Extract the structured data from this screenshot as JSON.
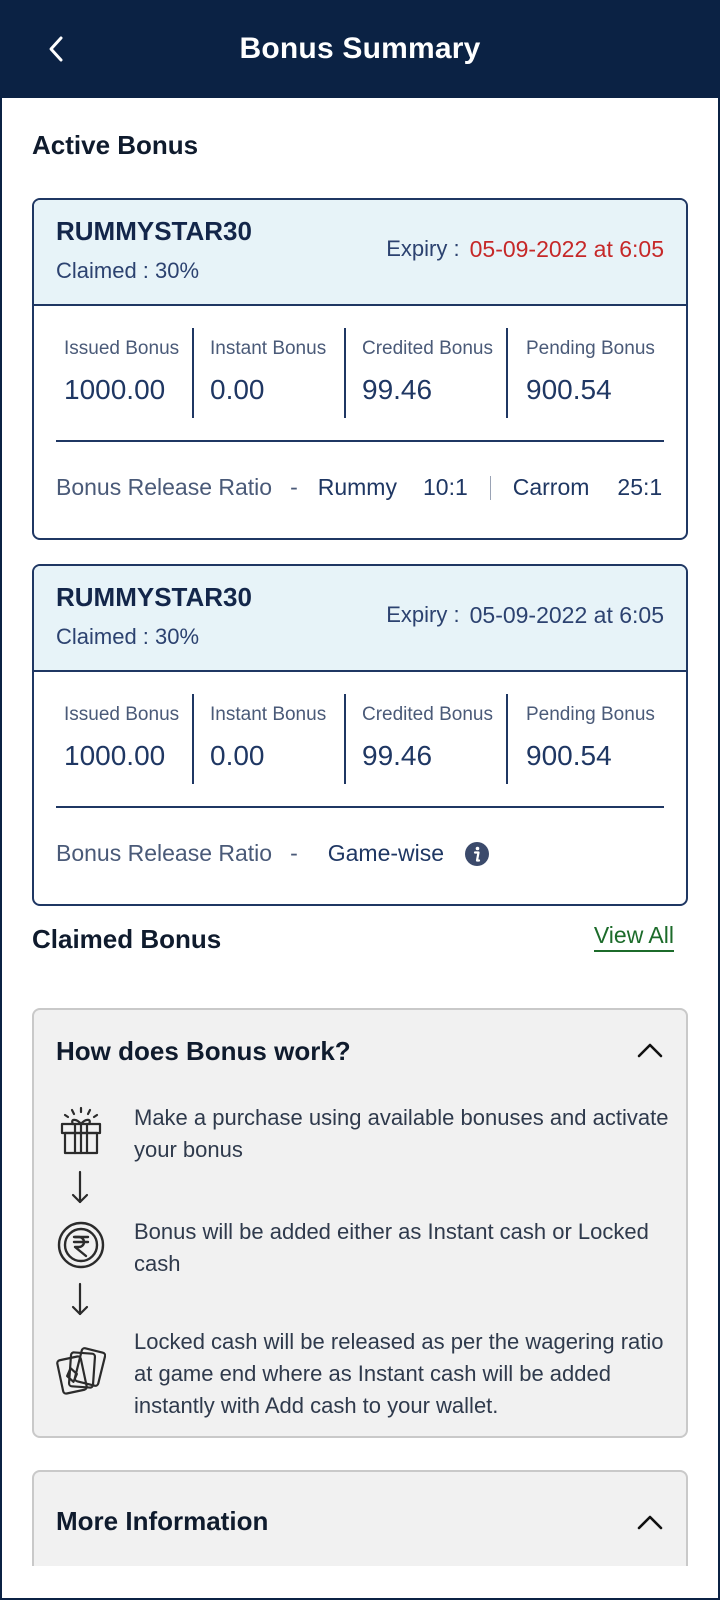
{
  "header": {
    "title": "Bonus Summary"
  },
  "active_section": {
    "title": "Active Bonus"
  },
  "cards": [
    {
      "code": "RUMMYSTAR30",
      "claimed": "Claimed : 30%",
      "expiry_label": "Expiry :",
      "expiry_value": "05-09-2022 at 6:05",
      "expiry_color": "#c62828",
      "stats": [
        {
          "label": "Issued Bonus",
          "value": "1000.00"
        },
        {
          "label": "Instant Bonus",
          "value": "0.00"
        },
        {
          "label": "Credited Bonus",
          "value": "99.46"
        },
        {
          "label": "Pending Bonus",
          "value": "900.54"
        }
      ],
      "ratio_label": "Bonus Release Ratio",
      "ratio_sep": "-",
      "ratio_items": [
        {
          "game": "Rummy",
          "ratio": "10:1"
        },
        {
          "game": "Carrom",
          "ratio": "25:1"
        }
      ]
    },
    {
      "code": "RUMMYSTAR30",
      "claimed": "Claimed : 30%",
      "expiry_label": "Expiry :",
      "expiry_value": "05-09-2022 at 6:05",
      "stats": [
        {
          "label": "Issued Bonus",
          "value": "1000.00"
        },
        {
          "label": "Instant Bonus",
          "value": "0.00"
        },
        {
          "label": "Credited Bonus",
          "value": "99.46"
        },
        {
          "label": "Pending Bonus",
          "value": "900.54"
        }
      ],
      "ratio_label": "Bonus Release Ratio",
      "ratio_sep": "-",
      "ratio_gamewise": "Game-wise",
      "info_icon": "info-icon"
    }
  ],
  "claimed_section": {
    "title": "Claimed Bonus",
    "view_all": "View All"
  },
  "how_it_works": {
    "title": "How does Bonus work?",
    "steps": [
      {
        "icon": "gift-icon",
        "text": "Make a purchase using available bonuses and activate your bonus"
      },
      {
        "icon": "rupee-coin-icon",
        "text": "Bonus will be added either as Instant cash or Locked cash"
      },
      {
        "icon": "playing-cards-icon",
        "text": "Locked cash will be released as per the wagering ratio at game end where as Instant cash will be added instantly with Add cash to your wallet."
      }
    ]
  },
  "more_info": {
    "title": "More Information"
  }
}
